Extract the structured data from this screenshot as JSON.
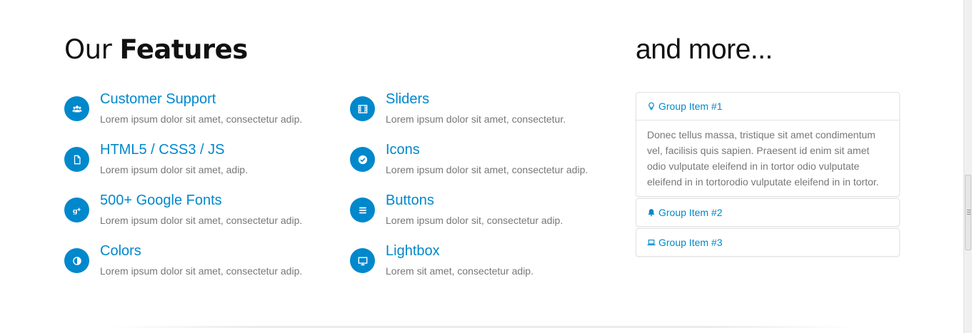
{
  "features_title": {
    "light": "Our ",
    "bold": "Features"
  },
  "more_title": "and more...",
  "accent_color": "#0088cc",
  "features": [
    {
      "icon": "users-icon",
      "title": "Customer Support",
      "desc": "Lorem ipsum dolor sit amet, consectetur adip."
    },
    {
      "icon": "file-icon",
      "title": "HTML5 / CSS3 / JS",
      "desc": "Lorem ipsum dolor sit amet, adip."
    },
    {
      "icon": "google-plus-icon",
      "title": "500+ Google Fonts",
      "desc": "Lorem ipsum dolor sit amet, consectetur adip."
    },
    {
      "icon": "adjust-icon",
      "title": "Colors",
      "desc": "Lorem ipsum dolor sit amet, consectetur adip."
    },
    {
      "icon": "film-icon",
      "title": "Sliders",
      "desc": "Lorem ipsum dolor sit amet, consectetur."
    },
    {
      "icon": "check-icon",
      "title": "Icons",
      "desc": "Lorem ipsum dolor sit amet, consectetur adip."
    },
    {
      "icon": "bars-icon",
      "title": "Buttons",
      "desc": "Lorem ipsum dolor sit, consectetur adip."
    },
    {
      "icon": "desktop-icon",
      "title": "Lightbox",
      "desc": "Lorem sit amet, consectetur adip."
    }
  ],
  "group_items": [
    {
      "icon": "lightbulb-icon",
      "label": "Group Item #1",
      "expanded": true,
      "body": "Donec tellus massa, tristique sit amet condimentum vel, facilisis quis sapien. Praesent id enim sit amet odio vulputate eleifend in in tortor odio vulputate eleifend in in tortorodio vulputate eleifend in in tortor."
    },
    {
      "icon": "bell-icon",
      "label": "Group Item #2",
      "expanded": false
    },
    {
      "icon": "laptop-icon",
      "label": "Group Item #3",
      "expanded": false
    }
  ]
}
